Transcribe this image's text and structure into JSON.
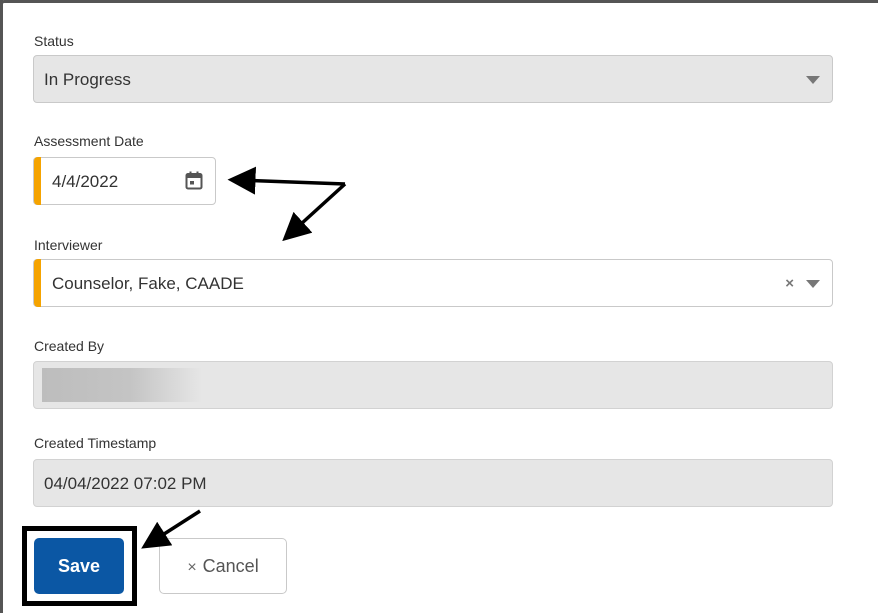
{
  "status": {
    "label": "Status",
    "value": "In Progress"
  },
  "assessment_date": {
    "label": "Assessment Date",
    "value": "4/4/2022"
  },
  "interviewer": {
    "label": "Interviewer",
    "value": "Counselor, Fake, CAADE"
  },
  "created_by": {
    "label": "Created By",
    "value": ""
  },
  "created_timestamp": {
    "label": "Created Timestamp",
    "value": "04/04/2022 07:02 PM"
  },
  "actions": {
    "save_label": "Save",
    "cancel_label": "Cancel",
    "cancel_icon": "×"
  },
  "colors": {
    "required_accent": "#f5a300",
    "primary_button": "#0b57a4",
    "disabled_field": "#e6e6e6",
    "annotation": "#000000"
  },
  "icons": {
    "date_picker": "calendar-icon",
    "dropdown": "chevron-down-icon",
    "clear": "clear-icon"
  }
}
